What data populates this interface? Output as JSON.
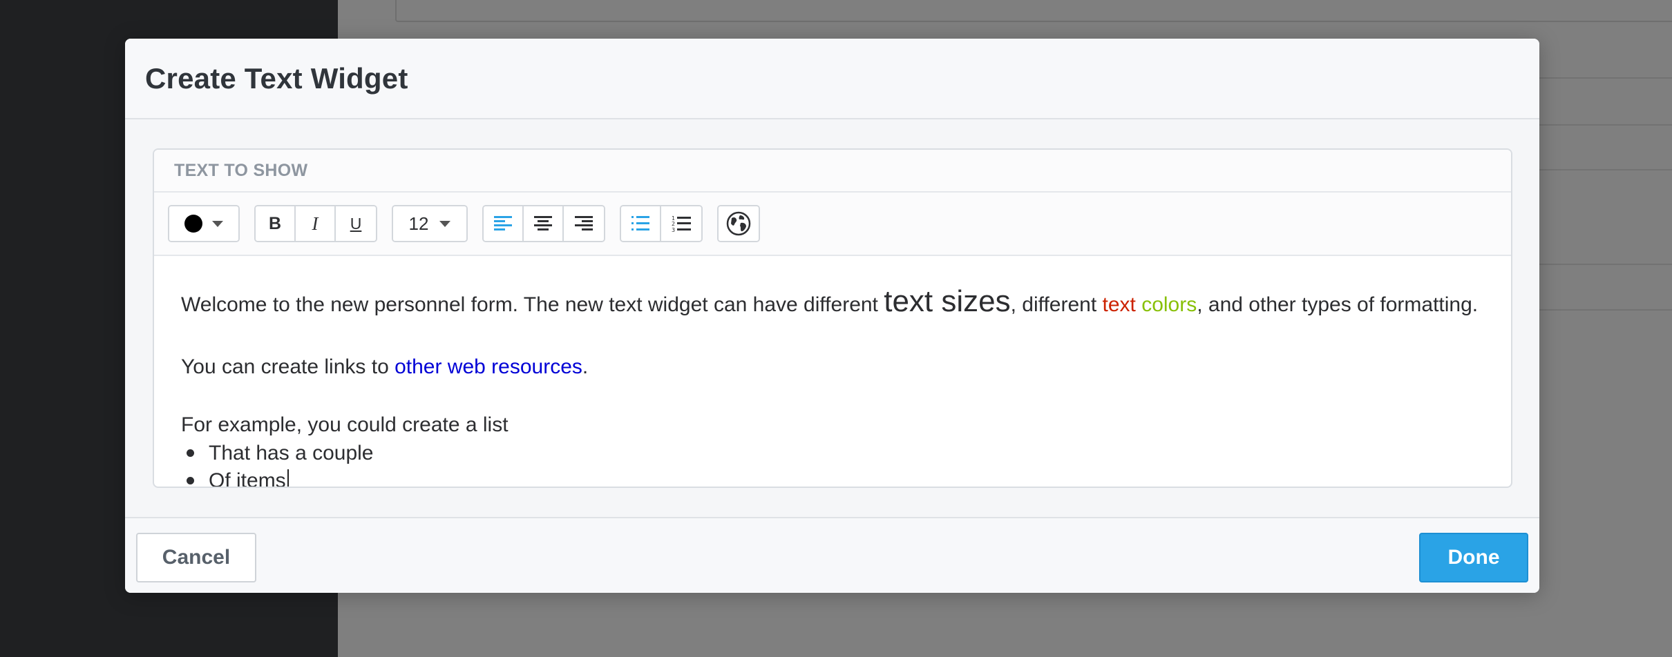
{
  "modal": {
    "title": "Create Text Widget",
    "panel_label": "TEXT TO SHOW",
    "cancel_label": "Cancel",
    "done_label": "Done"
  },
  "toolbar": {
    "color_value": "#000000",
    "bold_label": "B",
    "italic_label": "I",
    "underline_label": "U",
    "font_size": "12",
    "icons": [
      "align-left-icon",
      "align-center-icon",
      "align-right-icon",
      "bullet-list-icon",
      "numbered-list-icon",
      "globe-icon"
    ],
    "active_alignment": "left"
  },
  "editor": {
    "line1_part1": "Welcome to the new personnel form. The new text widget can have different ",
    "line1_big": "text sizes",
    "line1_part2": ", different ",
    "line1_red": "text",
    "line1_space": " ",
    "line1_green": "colors",
    "line1_part3": ", and other types of formatting.",
    "line2_part1": "You can create links to ",
    "line2_link": "other web resources",
    "line2_end": ".",
    "line3": "For example, you could create a list",
    "bullets": [
      "That has a couple",
      "Of items"
    ]
  },
  "colors": {
    "accent": "#2aa3e6",
    "red_text": "#cc2200",
    "green_text": "#88c008",
    "link": "#0000d6"
  }
}
